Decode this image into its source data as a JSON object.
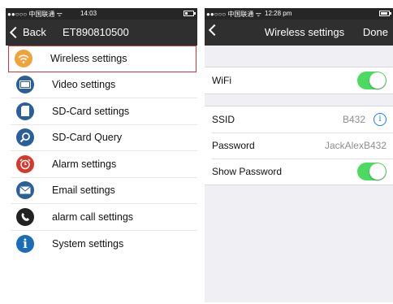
{
  "left": {
    "status": {
      "carrier": "●●○○○ 中国联通 ᯤ",
      "time": "14:03"
    },
    "nav": {
      "back_label": "Back",
      "title": "ET890810500"
    },
    "menu": [
      {
        "label": "Wireless settings",
        "icon": "wifi-icon"
      },
      {
        "label": "Video settings",
        "icon": "video-icon"
      },
      {
        "label": "SD-Card settings",
        "icon": "sd-card-icon"
      },
      {
        "label": "SD-Card Query",
        "icon": "magnifier-icon"
      },
      {
        "label": "Alarm settings",
        "icon": "alarm-clock-icon"
      },
      {
        "label": "Email settings",
        "icon": "envelope-icon"
      },
      {
        "label": "alarm call settings",
        "icon": "phone-icon"
      },
      {
        "label": "System settings",
        "icon": "info-icon"
      }
    ]
  },
  "right": {
    "status": {
      "carrier": "●●○○○ 中国联通 ᯤ",
      "time": "12:28 pm"
    },
    "nav": {
      "title": "Wireless settings",
      "done_label": "Done"
    },
    "wifi": {
      "label": "WiFi",
      "on": true
    },
    "ssid": {
      "label": "SSID",
      "value": "B432"
    },
    "password": {
      "label": "Password",
      "value": "JackAlexB432"
    },
    "show_password": {
      "label": "Show Password",
      "on": true
    }
  },
  "colors": {
    "toggle_on": "#4cd964",
    "selection_border": "#d4333b",
    "info_blue": "#1a7cf5"
  }
}
